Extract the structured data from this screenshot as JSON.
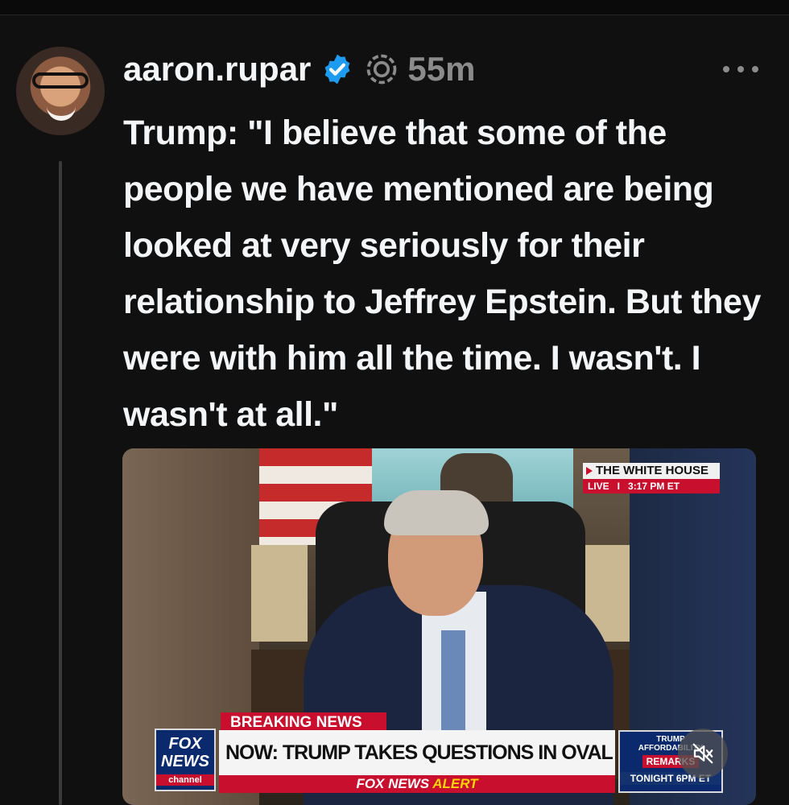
{
  "post": {
    "username": "aaron.rupar",
    "time": "55m",
    "text": "Trump: \"I believe that some of the people we have mentioned are being looked at very seriously for their relationship to Jeffrey Epstein. But they were with him all the time. I wasn't. I wasn't at all.\""
  },
  "icons": {
    "verified": "verified-badge-icon",
    "pinned": "threads-ring-icon",
    "more": "more-options-icon",
    "mute": "muted-speaker-icon"
  },
  "media": {
    "live_box": {
      "location": "THE WHITE HOUSE",
      "live": "LIVE",
      "separator": "I",
      "time": "3:17 PM ET"
    },
    "chyron": {
      "logo_line1": "FOX",
      "logo_line2": "NEWS",
      "logo_line3": "channel",
      "breaking": "BREAKING NEWS",
      "headline": "NOW: TRUMP TAKES QUESTIONS IN OVAL OFFICE",
      "alert_prefix": "FOX NEWS",
      "alert_word": "ALERT",
      "promo_line1": "TRUMP",
      "promo_line2": "AFFORDABILITY",
      "promo_line3": "REMARKS",
      "promo_line4": "TONIGHT 6PM ET"
    }
  },
  "colors": {
    "background": "#101010",
    "text": "#f3f5f7",
    "muted": "#8b8b8b",
    "verified": "#1d9bf0",
    "fox_red": "#c8102e",
    "fox_blue": "#0b2a6e"
  }
}
